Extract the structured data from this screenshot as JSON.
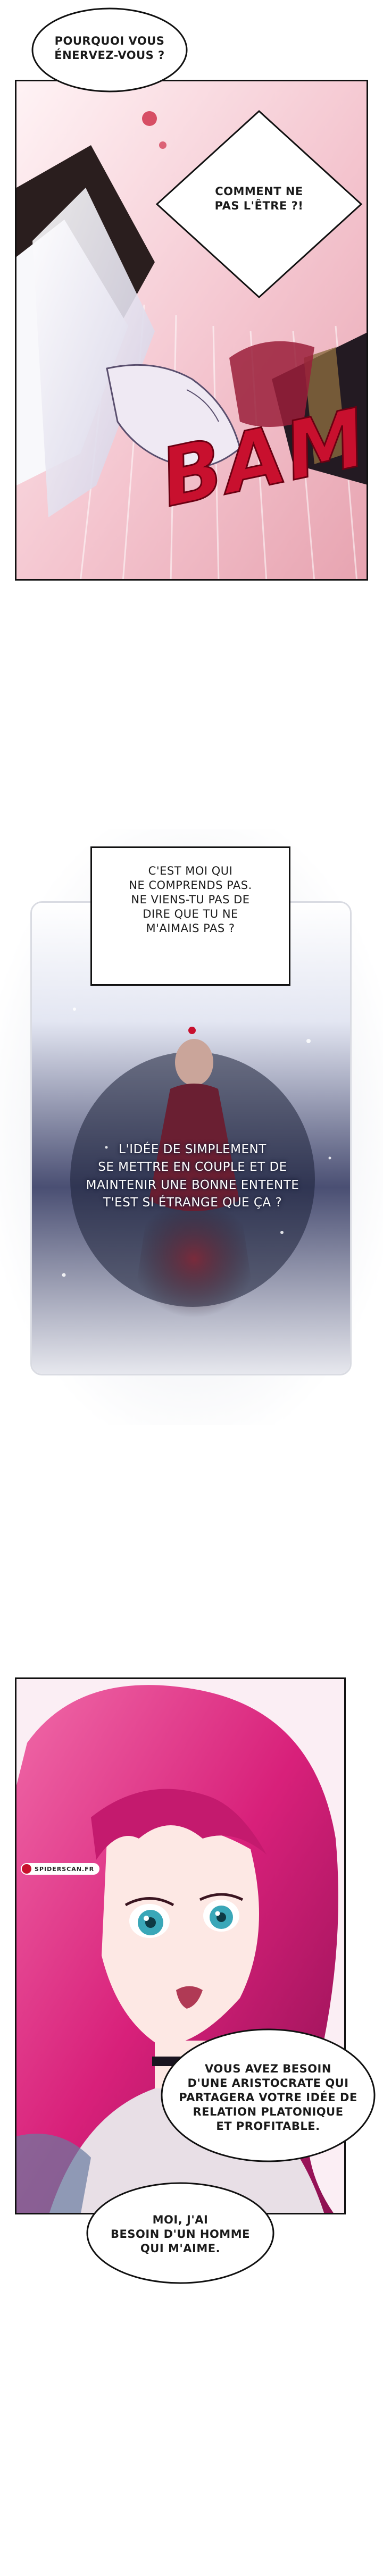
{
  "bubbles": {
    "b1": "POURQUOI VOUS\nÉNERVEZ-VOUS ?",
    "b2": "COMMENT NE\nPAS L'ÊTRE ?!",
    "b3": "C'EST MOI QUI\nNE COMPRENDS PAS.\nNE VIENS-TU PAS DE\nDIRE QUE TU NE\nM'AIMAIS PAS ?",
    "b4": "L'IDÉE DE SIMPLEMENT\nSE METTRE EN COUPLE ET DE\nMAINTENIR UNE BONNE ENTENTE\nT'EST SI ÉTRANGE QUE ÇA ?",
    "b5": "VOUS AVEZ BESOIN\nD'UNE ARISTOCRATE QUI\nPARTAGERA VOTRE IDÉE DE\nRELATION PLATONIQUE\nET PROFITABLE.",
    "b6": "MOI, J'AI\nBESOIN D'UN HOMME\nQUI M'AIME."
  },
  "sfx": "BAM",
  "watermark": "SPIDERSCAN.FR",
  "colors": {
    "sfx_red": "#c8102e",
    "hair_pink": "#d8207a",
    "eye_teal": "#3aa7b8",
    "night_blue": "#1c2038"
  }
}
